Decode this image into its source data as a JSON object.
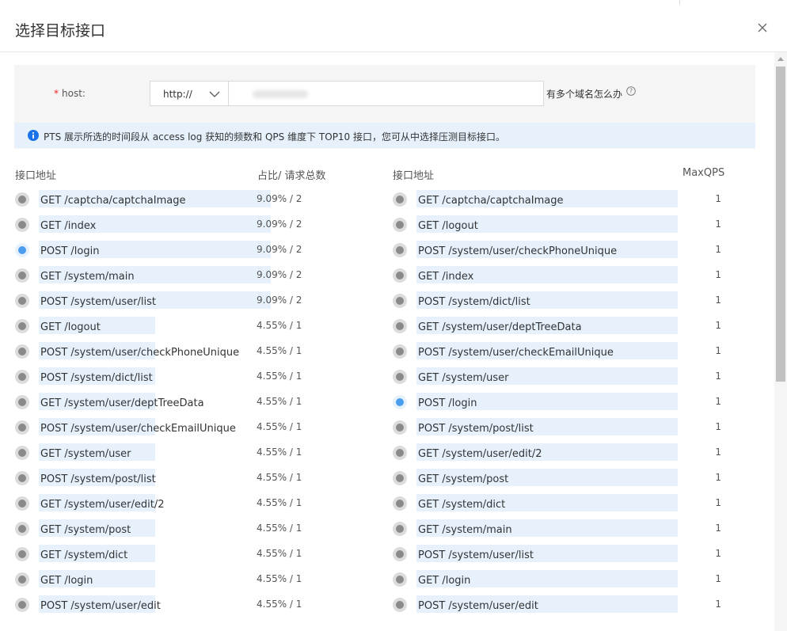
{
  "dialog": {
    "title": "选择目标接口"
  },
  "host": {
    "label": "host:",
    "required_mark": "*",
    "protocol": "http://",
    "value": "",
    "help_text": "有多个域名怎么办"
  },
  "info": {
    "text": "PTS 展示所选的时间段从 access log 获知的频数和 QPS 维度下 TOP10 接口，您可从中选择压测目标接口。"
  },
  "colors": {
    "accent": "#4a9ef0",
    "bar": "#e6f1fc",
    "radio_off": "#8a8a8a"
  },
  "left_table": {
    "col1": "接口地址",
    "col2": "占比/ 请求总数",
    "rows": [
      {
        "label": "GET /captcha/captchaImage",
        "value": "9.09% / 2",
        "share": 0.0909,
        "selected": false
      },
      {
        "label": "GET /index",
        "value": "9.09% / 2",
        "share": 0.0909,
        "selected": false
      },
      {
        "label": "POST /login",
        "value": "9.09% / 2",
        "share": 0.0909,
        "selected": true
      },
      {
        "label": "GET /system/main",
        "value": "9.09% / 2",
        "share": 0.0909,
        "selected": false
      },
      {
        "label": "POST /system/user/list",
        "value": "9.09% / 2",
        "share": 0.0909,
        "selected": false
      },
      {
        "label": "GET /logout",
        "value": "4.55% / 1",
        "share": 0.0455,
        "selected": false
      },
      {
        "label": "POST /system/user/checkPhoneUnique",
        "value": "4.55% / 1",
        "share": 0.0455,
        "selected": false
      },
      {
        "label": "POST /system/dict/list",
        "value": "4.55% / 1",
        "share": 0.0455,
        "selected": false
      },
      {
        "label": "GET /system/user/deptTreeData",
        "value": "4.55% / 1",
        "share": 0.0455,
        "selected": false
      },
      {
        "label": "POST /system/user/checkEmailUnique",
        "value": "4.55% / 1",
        "share": 0.0455,
        "selected": false
      },
      {
        "label": "GET /system/user",
        "value": "4.55% / 1",
        "share": 0.0455,
        "selected": false
      },
      {
        "label": "POST /system/post/list",
        "value": "4.55% / 1",
        "share": 0.0455,
        "selected": false
      },
      {
        "label": "GET /system/user/edit/2",
        "value": "4.55% / 1",
        "share": 0.0455,
        "selected": false
      },
      {
        "label": "GET /system/post",
        "value": "4.55% / 1",
        "share": 0.0455,
        "selected": false
      },
      {
        "label": "GET /system/dict",
        "value": "4.55% / 1",
        "share": 0.0455,
        "selected": false
      },
      {
        "label": "GET /login",
        "value": "4.55% / 1",
        "share": 0.0455,
        "selected": false
      },
      {
        "label": "POST /system/user/edit",
        "value": "4.55% / 1",
        "share": 0.0455,
        "selected": false
      }
    ]
  },
  "right_table": {
    "col1": "接口地址",
    "col2": "MaxQPS",
    "rows": [
      {
        "label": "GET /captcha/captchaImage",
        "value": "1",
        "selected": false
      },
      {
        "label": "GET /logout",
        "value": "1",
        "selected": false
      },
      {
        "label": "POST /system/user/checkPhoneUnique",
        "value": "1",
        "selected": false
      },
      {
        "label": "GET /index",
        "value": "1",
        "selected": false
      },
      {
        "label": "POST /system/dict/list",
        "value": "1",
        "selected": false
      },
      {
        "label": "GET /system/user/deptTreeData",
        "value": "1",
        "selected": false
      },
      {
        "label": "POST /system/user/checkEmailUnique",
        "value": "1",
        "selected": false
      },
      {
        "label": "GET /system/user",
        "value": "1",
        "selected": false
      },
      {
        "label": "POST /login",
        "value": "1",
        "selected": true
      },
      {
        "label": "POST /system/post/list",
        "value": "1",
        "selected": false
      },
      {
        "label": "GET /system/user/edit/2",
        "value": "1",
        "selected": false
      },
      {
        "label": "GET /system/post",
        "value": "1",
        "selected": false
      },
      {
        "label": "GET /system/dict",
        "value": "1",
        "selected": false
      },
      {
        "label": "GET /system/main",
        "value": "1",
        "selected": false
      },
      {
        "label": "POST /system/user/list",
        "value": "1",
        "selected": false
      },
      {
        "label": "GET /login",
        "value": "1",
        "selected": false
      },
      {
        "label": "POST /system/user/edit",
        "value": "1",
        "selected": false
      }
    ]
  }
}
